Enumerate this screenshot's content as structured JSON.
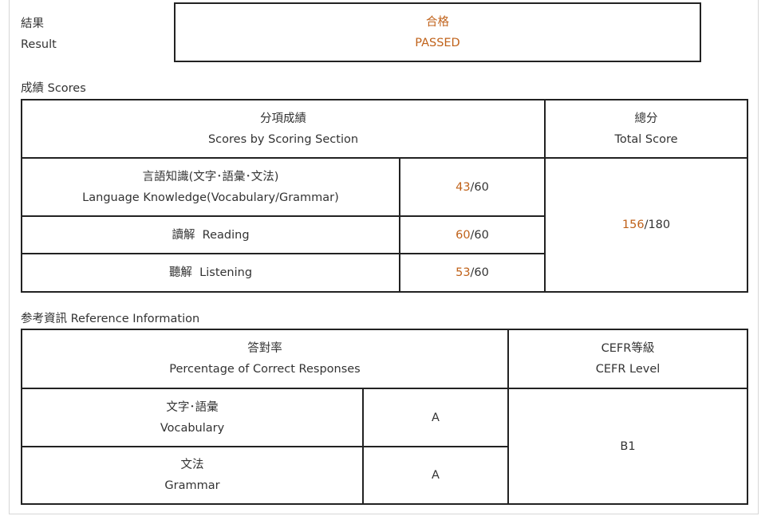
{
  "result": {
    "label_ja": "結果",
    "label_en": "Result",
    "value_ja": "合格",
    "value_en": "PASSED"
  },
  "scores": {
    "title": "成績 Scores",
    "section_header_ja": "分項成績",
    "section_header_en": "Scores by Scoring Section",
    "total_header_ja": "總分",
    "total_header_en": "Total Score",
    "rows": [
      {
        "label_ja": "言語知識(文字･語彙･文法)",
        "label_en": "Language Knowledge(Vocabulary/Grammar)",
        "score": "43",
        "max": "/60"
      },
      {
        "label": "讀解  Reading",
        "score": "60",
        "max": "/60"
      },
      {
        "label": "聽解  Listening",
        "score": "53",
        "max": "/60"
      }
    ],
    "total_score": "156",
    "total_max": "/180"
  },
  "reference": {
    "title": "参考資訊 Reference Information",
    "pct_header_ja": "答對率",
    "pct_header_en": "Percentage of Correct Responses",
    "cefr_header_ja": "CEFR等級",
    "cefr_header_en": "CEFR Level",
    "rows": [
      {
        "label_ja": "文字･語彙",
        "label_en": "Vocabulary",
        "grade": "A"
      },
      {
        "label_ja": "文法",
        "label_en": "Grammar",
        "grade": "A"
      }
    ],
    "cefr_level": "B1"
  },
  "colors": {
    "accent": "#c0621a",
    "border": "#222222",
    "text": "#333333"
  }
}
